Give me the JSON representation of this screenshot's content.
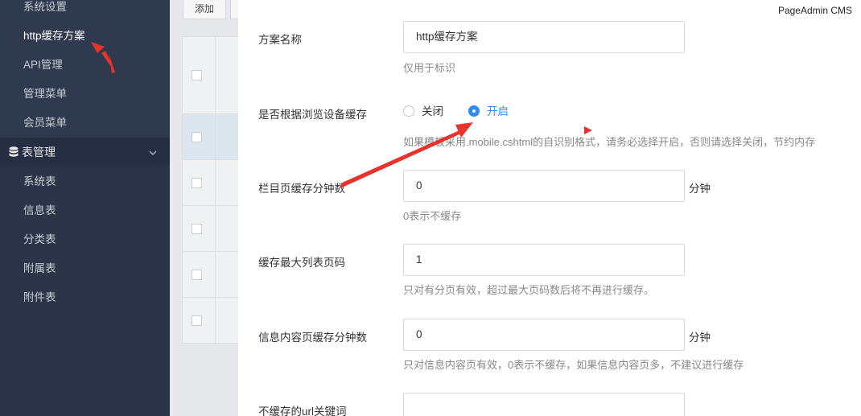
{
  "sidebar": {
    "items_top": [
      {
        "label": "系统设置"
      },
      {
        "label": "http缓存方案"
      },
      {
        "label": "API管理"
      },
      {
        "label": "管理菜单"
      },
      {
        "label": "会员菜单"
      }
    ],
    "group": {
      "label": "表管理",
      "icon": "database-icon",
      "chevron": "chevron-down-icon"
    },
    "items_bottom": [
      {
        "label": "系统表"
      },
      {
        "label": "信息表"
      },
      {
        "label": "分类表"
      },
      {
        "label": "附属表"
      },
      {
        "label": "附件表"
      }
    ]
  },
  "background_page": {
    "add_label": "添加"
  },
  "panel": {
    "brand": "PageAdmin CMS",
    "fields": {
      "scheme_name": {
        "label": "方案名称",
        "value": "http缓存方案",
        "help": "仅用于标识"
      },
      "device_cache": {
        "label": "是否根据浏览设备缓存",
        "options": [
          {
            "label": "关闭",
            "checked": false
          },
          {
            "label": "开启",
            "checked": true
          }
        ],
        "help": "如果模板采用.mobile.cshtml的自识别格式，请务必选择开启，否则请选择关闭，节约内存"
      },
      "column_cache": {
        "label": "栏目页缓存分钟数",
        "value": "0",
        "unit": "分钟",
        "help": "0表示不缓存"
      },
      "max_list_page": {
        "label": "缓存最大列表页码",
        "value": "1",
        "help": "只对有分页有效，超过最大页码数后将不再进行缓存。"
      },
      "content_cache": {
        "label": "信息内容页缓存分钟数",
        "value": "0",
        "unit": "分钟",
        "help": "只对信息内容页有效，0表示不缓存，如果信息内容页多，不建议进行缓存"
      },
      "no_cache_url": {
        "label": "不缓存的url关键词",
        "value": ""
      }
    }
  },
  "colors": {
    "sidebar_bg": "#2f3a4f",
    "accent": "#2d8cf0",
    "annotation": "#e8322b"
  }
}
